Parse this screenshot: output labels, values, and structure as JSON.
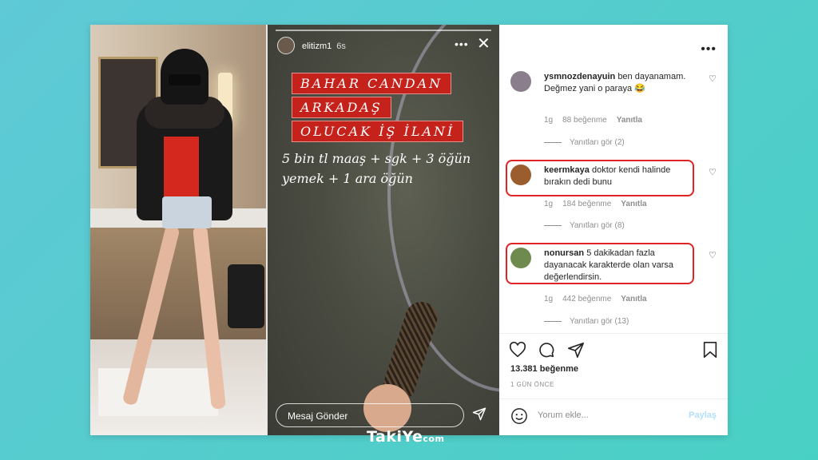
{
  "story": {
    "username": "elitizm1",
    "time": "6s",
    "banner_1": "BAHAR CANDAN",
    "banner_2": "ARKADAŞ",
    "banner_3": "OLUCAK İŞ İLANİ",
    "body_text": "5 bin tl maaş + sgk + 3 öğün yemek + 1 ara öğün",
    "message_placeholder": "Mesaj Gönder"
  },
  "comments": [
    {
      "username": "ysmnozdenayuin",
      "text": "ben dayanamam. Değmez yani o paraya 😂",
      "time": "1g",
      "likes": "88 beğenme",
      "reply": "Yanıtla",
      "view_replies": "Yanıtları gör (2)"
    },
    {
      "username": "keermkaya",
      "text": "doktor kendi halinde bırakın dedi bunu",
      "time": "1g",
      "likes": "184 beğenme",
      "reply": "Yanıtla",
      "view_replies": "Yanıtları gör (8)"
    },
    {
      "username": "nonursan",
      "text": "5 dakikadan fazla dayanacak karakterde olan varsa değerlendirsin.",
      "time": "1g",
      "likes": "442 beğenme",
      "reply": "Yanıtla",
      "view_replies": "Yanıtları gör (13)"
    }
  ],
  "post": {
    "likes": "13.381 beğenme",
    "date": "1 GÜN ÖNCE",
    "add_comment_placeholder": "Yorum ekle...",
    "share_label": "Paylaş"
  },
  "watermark": {
    "brand": "TakiYe",
    "suffix": "com"
  },
  "colors": {
    "background": "#4fcfca",
    "highlight": "#e02323",
    "banner_red": "#c5221b"
  }
}
